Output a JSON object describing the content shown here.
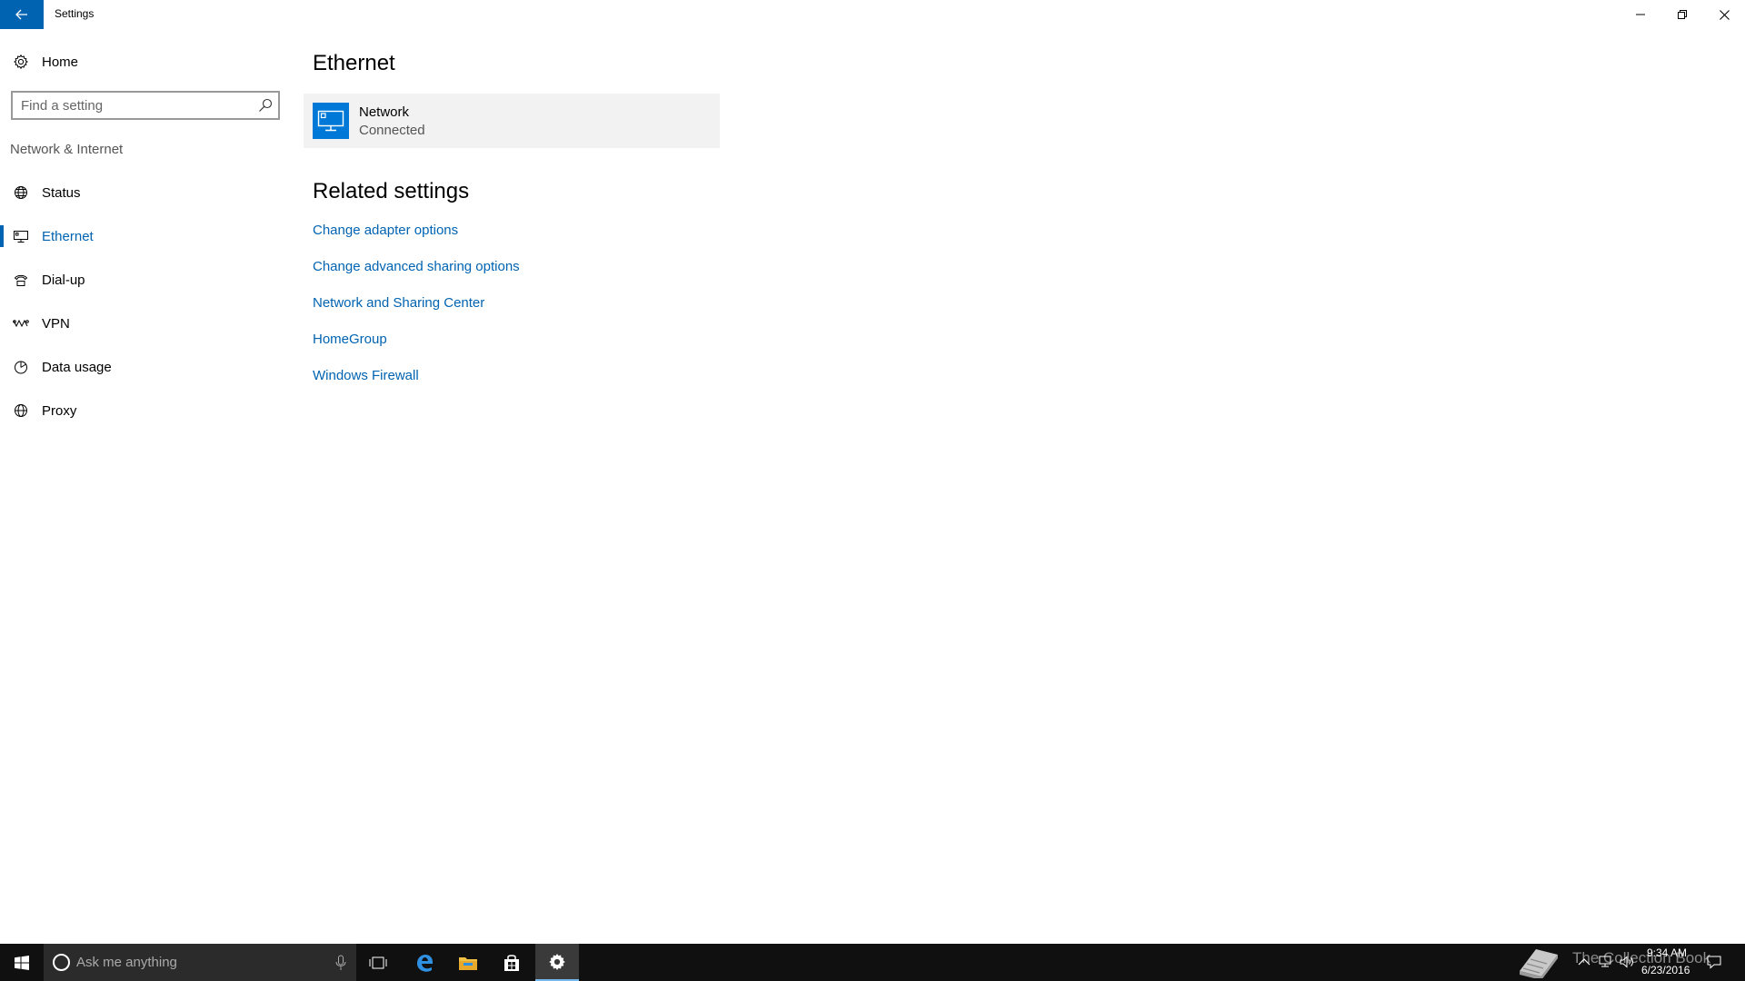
{
  "window": {
    "title": "Settings"
  },
  "sidebar": {
    "home_label": "Home",
    "search_placeholder": "Find a setting",
    "section_label": "Network & Internet",
    "items": [
      {
        "label": "Status",
        "icon": "status-globe-icon"
      },
      {
        "label": "Ethernet",
        "icon": "ethernet-icon",
        "selected": true
      },
      {
        "label": "Dial-up",
        "icon": "dial-up-icon"
      },
      {
        "label": "VPN",
        "icon": "vpn-icon"
      },
      {
        "label": "Data usage",
        "icon": "data-usage-icon"
      },
      {
        "label": "Proxy",
        "icon": "proxy-globe-icon"
      }
    ]
  },
  "main": {
    "title": "Ethernet",
    "network": {
      "name": "Network",
      "status": "Connected"
    },
    "related_title": "Related settings",
    "links": [
      "Change adapter options",
      "Change advanced sharing options",
      "Network and Sharing Center",
      "HomeGroup",
      "Windows Firewall"
    ]
  },
  "taskbar": {
    "search_placeholder": "Ask me anything",
    "watermark": "The Collection Book",
    "time": "9:34 AM",
    "date": "6/23/2016"
  },
  "colors": {
    "accent": "#0063b1",
    "tile": "#0078d7",
    "taskbar": "#101010"
  }
}
